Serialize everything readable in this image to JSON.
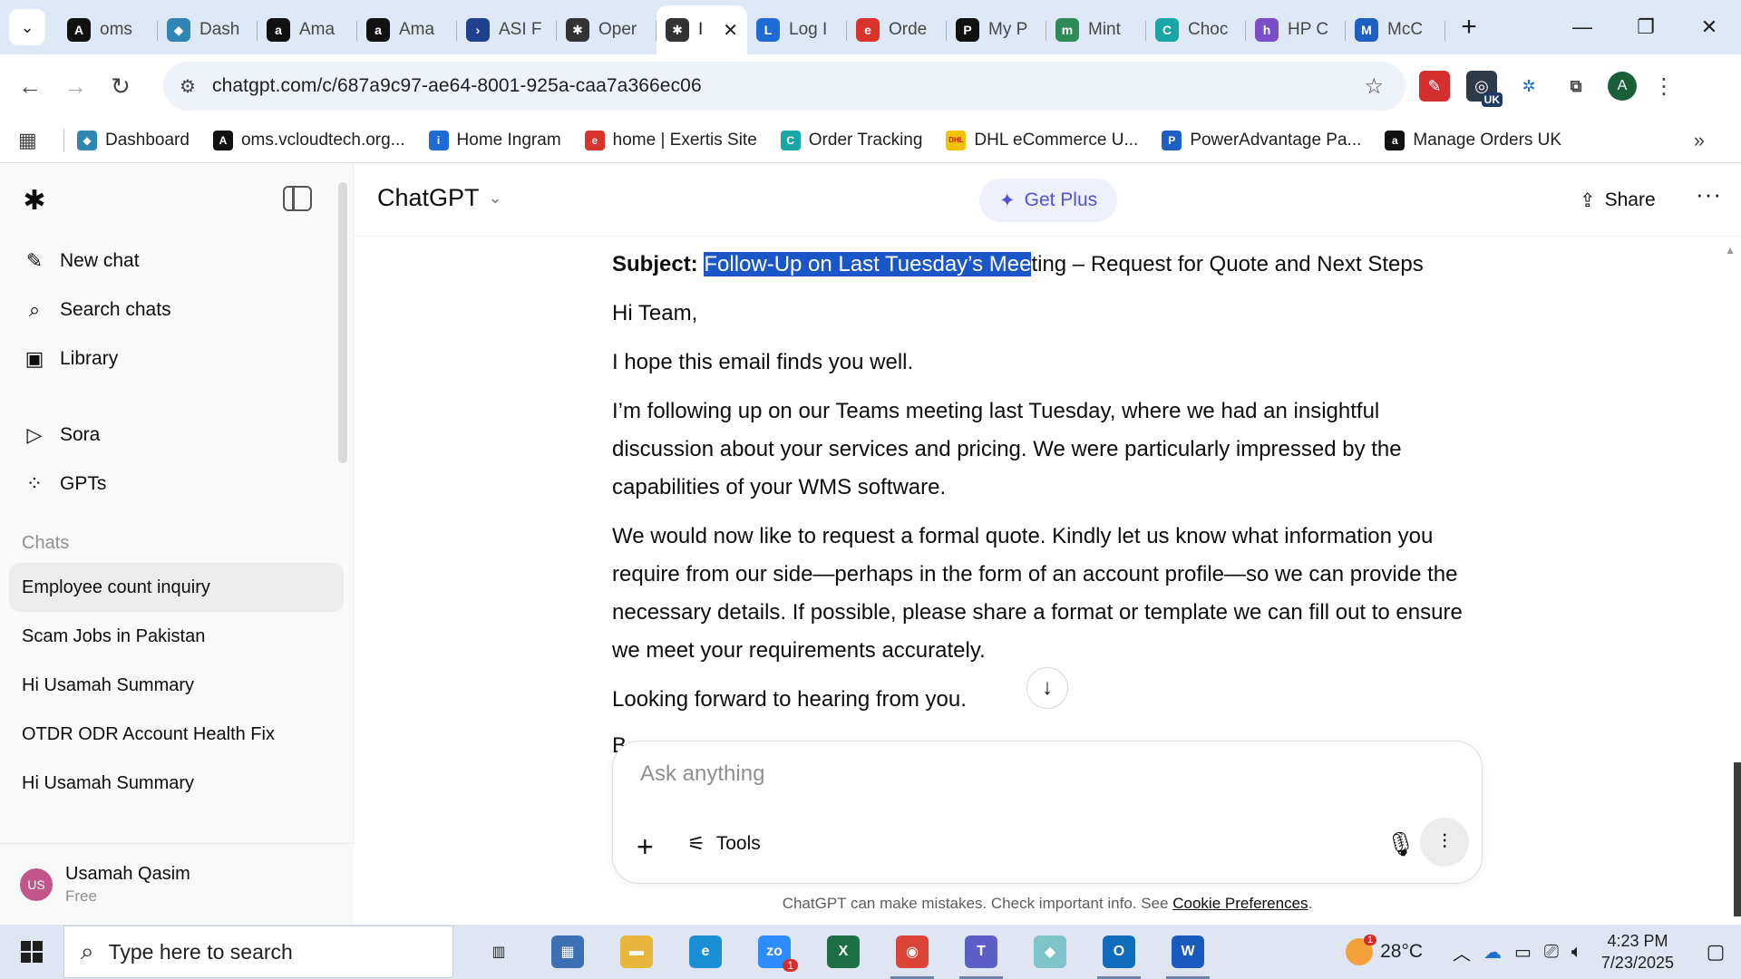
{
  "browser": {
    "tabs": [
      {
        "title": "oms",
        "fav": "A",
        "color": "#111111"
      },
      {
        "title": "Dash",
        "fav": "◆",
        "color": "#2f86b5"
      },
      {
        "title": "Ama",
        "fav": "a",
        "color": "#111111"
      },
      {
        "title": "Ama",
        "fav": "a",
        "color": "#111111"
      },
      {
        "title": "ASI F",
        "fav": "›",
        "color": "#1f3f8f"
      },
      {
        "title": "Oper",
        "fav": "✱",
        "color": "#333333"
      },
      {
        "title": "I",
        "fav": "✱",
        "color": "#333333",
        "active": true
      },
      {
        "title": "Log I",
        "fav": "L",
        "color": "#1e6bd6"
      },
      {
        "title": "Orde",
        "fav": "e",
        "color": "#d9342b"
      },
      {
        "title": "My P",
        "fav": "P",
        "color": "#111111"
      },
      {
        "title": "Mint",
        "fav": "m",
        "color": "#2e8b57"
      },
      {
        "title": "Choc",
        "fav": "C",
        "color": "#1aa6a6"
      },
      {
        "title": "HP C",
        "fav": "h",
        "color": "#7a4dc9"
      },
      {
        "title": "McC",
        "fav": "M",
        "color": "#1e5fc2"
      }
    ],
    "url": "chatgpt.com/c/687a9c97-ae64-8001-925a-caa7a366ec06",
    "bookmarks": [
      {
        "label": "Dashboard",
        "fav": "◆",
        "color": "#2f86b5"
      },
      {
        "label": "oms.vcloudtech.org...",
        "fav": "A",
        "color": "#111111"
      },
      {
        "label": "Home Ingram",
        "fav": "i",
        "color": "#1e6bd6"
      },
      {
        "label": "home | Exertis Site",
        "fav": "e",
        "color": "#d9342b"
      },
      {
        "label": "Order Tracking",
        "fav": "C",
        "color": "#1aa6a6"
      },
      {
        "label": "DHL eCommerce U...",
        "fav": "DHL",
        "color": "#f2c200"
      },
      {
        "label": "PowerAdvantage Pa...",
        "fav": "P",
        "color": "#1e5fc2"
      },
      {
        "label": "Manage Orders UK",
        "fav": "a",
        "color": "#111111"
      }
    ],
    "ext_badge": "UK",
    "profile_initial": "A"
  },
  "sidebar": {
    "nav": [
      {
        "label": "New chat",
        "icon": "✎"
      },
      {
        "label": "Search chats",
        "icon": "⌕"
      },
      {
        "label": "Library",
        "icon": "▣"
      }
    ],
    "nav2": [
      {
        "label": "Sora",
        "icon": "▷"
      },
      {
        "label": "GPTs",
        "icon": "⁘"
      }
    ],
    "section_label": "Chats",
    "chats": [
      "Employee count inquiry",
      "Scam Jobs in Pakistan",
      "Hi Usamah Summary",
      "OTDR ODR Account Health Fix",
      "Hi Usamah Summary"
    ],
    "user": {
      "initials": "US",
      "name": "Usamah Qasim",
      "plan": "Free"
    }
  },
  "main": {
    "model": "ChatGPT",
    "get_plus": "Get Plus",
    "share": "Share",
    "message": {
      "subject_label": "Subject:",
      "subject_highlight": "Follow-Up on Last Tuesday’s Mee",
      "subject_rest": "ting – Request for Quote and Next Steps",
      "greeting": "Hi Team,",
      "p1": "I hope this email finds you well.",
      "p2": "I’m following up on our Teams meeting last Tuesday, where we had an insightful discussion about your services and pricing. We were particularly impressed by the capabilities of your WMS software.",
      "p3": "We would now like to request a formal quote. Kindly let us know what information you require from our side—perhaps in the form of an account profile—so we can provide the necessary details. If possible, please share a format or template we can fill out to ensure we meet your requirements accurately.",
      "p4": "Looking forward to hearing from you.",
      "clipped": "B"
    },
    "composer": {
      "placeholder": "Ask anything",
      "tools": "Tools"
    },
    "disclaimer": "ChatGPT can make mistakes. Check important info. See",
    "disclaimer_link": "Cookie Preferences",
    "disclaimer_end": "."
  },
  "taskbar": {
    "search_placeholder": "Type here to search",
    "apps": [
      {
        "name": "task-view",
        "glyph": "▥",
        "color": "#dfe6f1",
        "fg": "#1f1f1f"
      },
      {
        "name": "calculator",
        "glyph": "▦",
        "color": "#3c6fb4",
        "fg": "#ffffff"
      },
      {
        "name": "file-explorer",
        "glyph": "▬",
        "color": "#e8b63a",
        "fg": "#ffffff"
      },
      {
        "name": "edge",
        "glyph": "e",
        "color": "#1b8fd6",
        "fg": "#ffffff"
      },
      {
        "name": "zoom",
        "glyph": "zo",
        "color": "#2d8cff",
        "fg": "#ffffff",
        "badge": "1"
      },
      {
        "name": "excel",
        "glyph": "X",
        "color": "#1d7044",
        "fg": "#ffffff"
      },
      {
        "name": "chrome",
        "glyph": "◉",
        "color": "#db4437",
        "fg": "#ffffff",
        "running": true
      },
      {
        "name": "teams",
        "glyph": "T",
        "color": "#5b5fc7",
        "fg": "#ffffff",
        "running": true
      },
      {
        "name": "app-diamond",
        "glyph": "◆",
        "color": "#7fc4c9",
        "fg": "#ffffff"
      },
      {
        "name": "outlook",
        "glyph": "O",
        "color": "#0f6cbd",
        "fg": "#ffffff",
        "running": true
      },
      {
        "name": "word",
        "glyph": "W",
        "color": "#185abd",
        "fg": "#ffffff",
        "running": true
      }
    ],
    "weather_badge": "1",
    "temperature": "28°C",
    "time": "4:23 PM",
    "date": "7/23/2025"
  }
}
